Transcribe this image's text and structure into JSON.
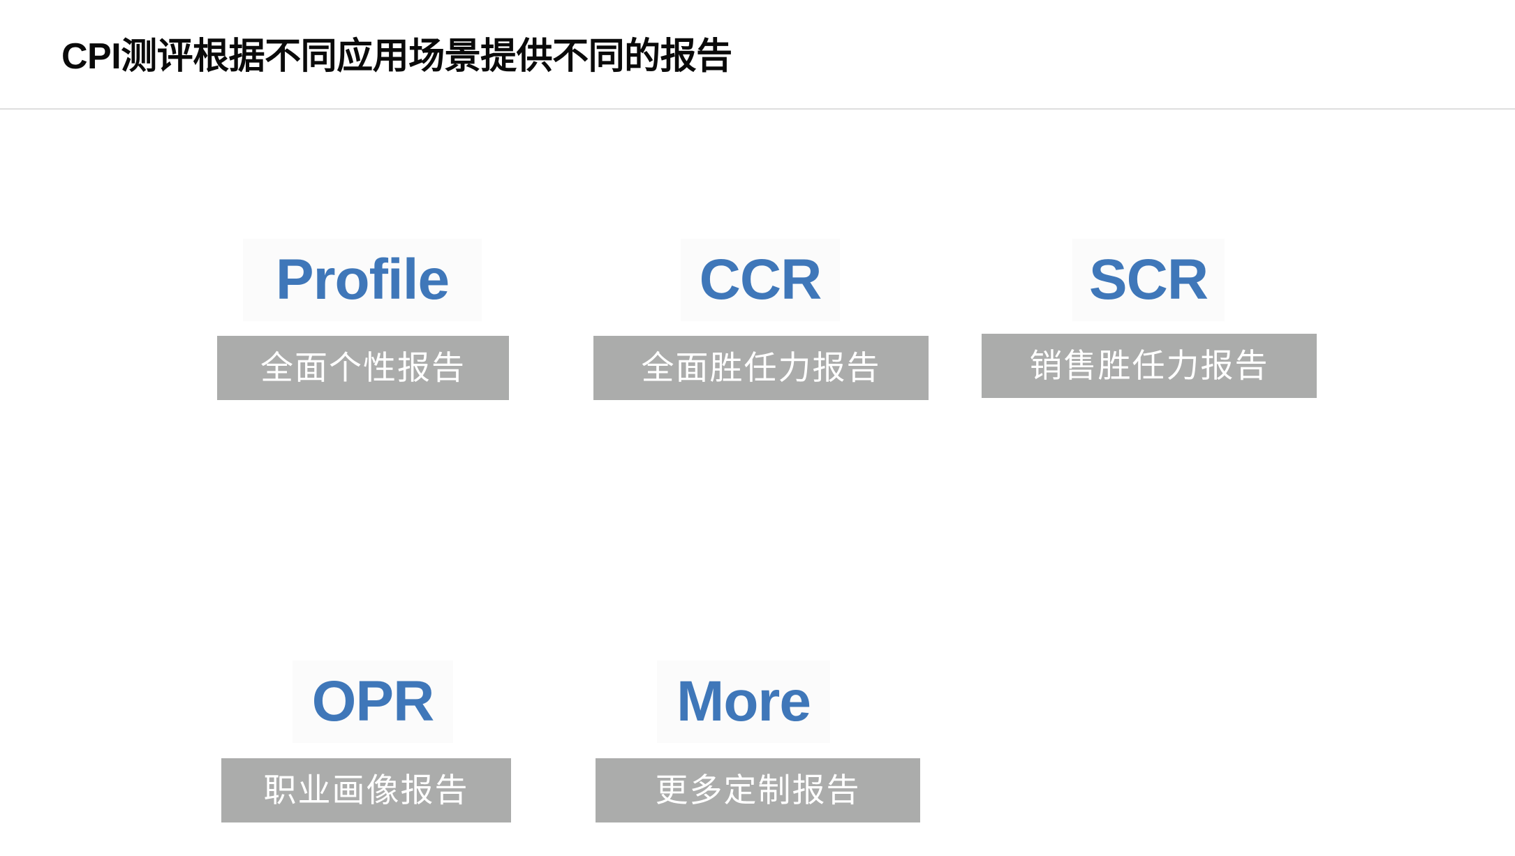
{
  "slide": {
    "title": "CPI测评根据不同应用场景提供不同的报告",
    "accent_blue": "#3f77b9",
    "label_gray": "#abacab",
    "plate_white": "#fbfbfb",
    "divider_color": "#dedede",
    "background": "#ffffff"
  },
  "cards": [
    {
      "acronym": "Profile",
      "label": "全面个性报告",
      "row": 1,
      "column": 1
    },
    {
      "acronym": "CCR",
      "label": "全面胜任力报告",
      "row": 1,
      "column": 2
    },
    {
      "acronym": "SCR",
      "label": "销售胜任力报告",
      "row": 1,
      "column": 3
    },
    {
      "acronym": "OPR",
      "label": "职业画像报告",
      "row": 2,
      "column": 1
    },
    {
      "acronym": "More",
      "label": "更多定制报告",
      "row": 2,
      "column": 2
    }
  ]
}
